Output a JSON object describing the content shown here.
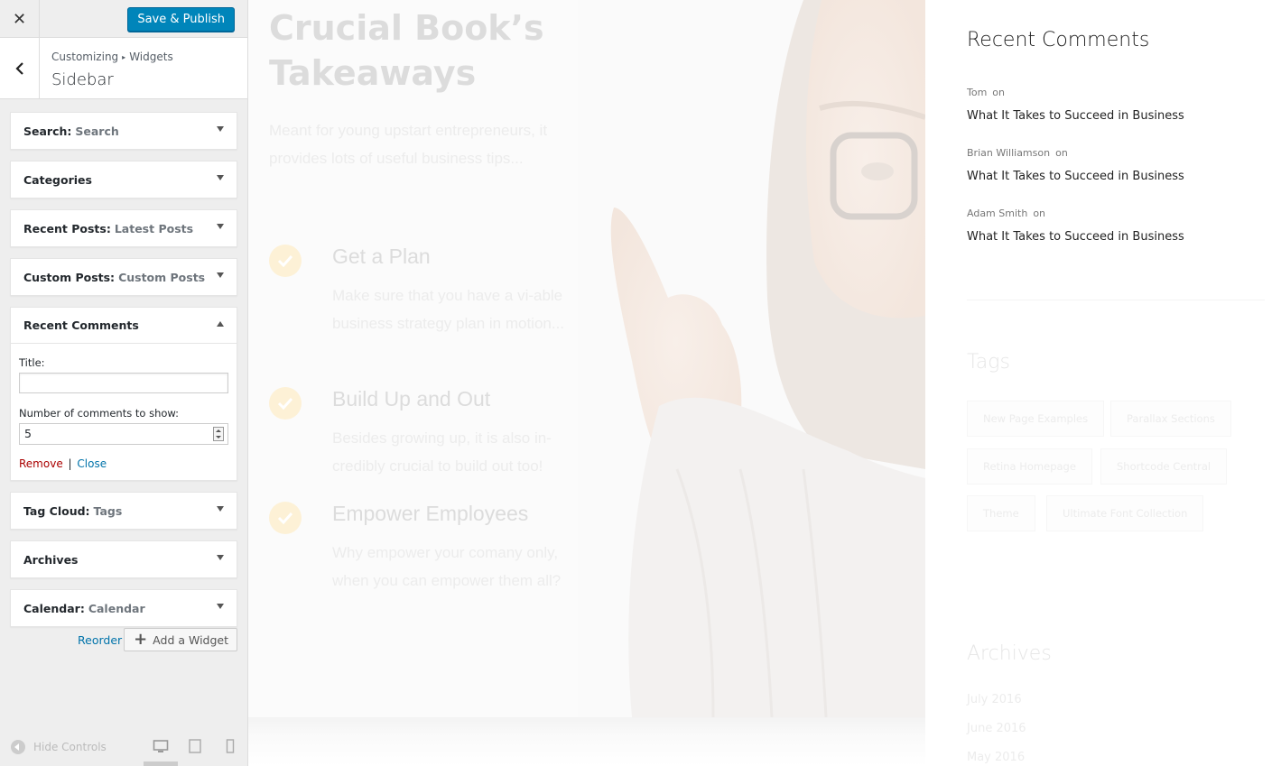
{
  "customizer": {
    "close_icon": "close-icon",
    "publish_label": "Save & Publish",
    "breadcrumb": [
      "Customizing",
      "Widgets"
    ],
    "breadcrumb_separator": "▸",
    "section_title": "Sidebar",
    "accent_color": "#0085ba",
    "widgets": [
      {
        "title": "Search:",
        "subtitle": "Search"
      },
      {
        "title": "Categories",
        "subtitle": ""
      },
      {
        "title": "Recent Posts:",
        "subtitle": "Latest Posts"
      },
      {
        "title": "Custom Posts:",
        "subtitle": "Custom Posts"
      },
      {
        "title": "Recent Comments",
        "subtitle": ""
      },
      {
        "title": "Tag Cloud:",
        "subtitle": "Tags"
      },
      {
        "title": "Archives",
        "subtitle": ""
      },
      {
        "title": "Calendar:",
        "subtitle": "Calendar"
      }
    ],
    "open_widget": {
      "title_label": "Title:",
      "title_value": "",
      "number_label": "Number of comments to show:",
      "number_value": "5",
      "remove_label": "Remove",
      "separator": "|",
      "close_label": "Close"
    },
    "reorder_label": "Reorder",
    "add_widget_label": "Add a Widget",
    "hide_controls_label": "Hide Controls"
  },
  "preview": {
    "hero_title": "Crucial Book’s Takeaways",
    "hero_text": "Meant for young upstart entrepreneurs, it provides lots of useful business tips...",
    "features": [
      {
        "title": "Get a Plan",
        "text": "Make sure that you have a vi-able business strategy plan in motion..."
      },
      {
        "title": "Build Up and Out",
        "text": "Besides growing up, it is also in-credibly crucial to build out too!"
      },
      {
        "title": "Empower Employees",
        "text": "Why empower your comany only, when you can empower them all?"
      }
    ],
    "sidebar": {
      "recent_comments_heading": "Recent Comments",
      "on_label": "on",
      "comments": [
        {
          "author": "Tom",
          "post": "What It Takes to Succeed in Business"
        },
        {
          "author": "Brian Williamson",
          "post": "What It Takes to Succeed in Business"
        },
        {
          "author": "Adam Smith",
          "post": "What It Takes to Succeed in Business"
        }
      ],
      "tags_heading": "Tags",
      "tags": [
        "New Page Examples",
        "Parallax Sections",
        "Retina Homepage",
        "Shortcode Central",
        "Theme",
        "Ultimate Font Collection"
      ],
      "archives_heading": "Archives",
      "archives": [
        "July 2016",
        "June 2016",
        "May 2016"
      ]
    }
  }
}
